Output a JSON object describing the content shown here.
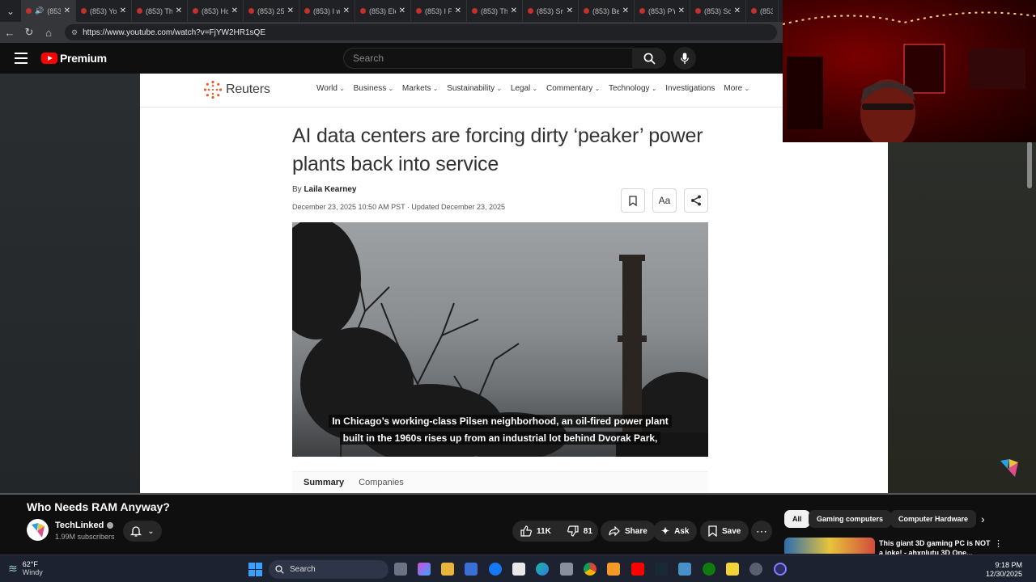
{
  "browser": {
    "tabs": [
      {
        "title": "(853",
        "active": true
      },
      {
        "title": "(853) Yo"
      },
      {
        "title": "(853) Th"
      },
      {
        "title": "(853) Ho"
      },
      {
        "title": "(853) 25"
      },
      {
        "title": "(853) I w"
      },
      {
        "title": "(853) Ele"
      },
      {
        "title": "(853) I F"
      },
      {
        "title": "(853) Th"
      },
      {
        "title": "(853) Sm"
      },
      {
        "title": "(853) Be"
      },
      {
        "title": "(853) PY"
      },
      {
        "title": "(853) So"
      },
      {
        "title": "(853"
      }
    ],
    "url": "https://www.youtube.com/watch?v=FjYW2HR1sQE"
  },
  "youtube": {
    "logo_text": "Premium",
    "search_placeholder": "Search"
  },
  "article": {
    "site": "Reuters",
    "nav": [
      "World",
      "Business",
      "Markets",
      "Sustainability",
      "Legal",
      "Commentary",
      "Technology",
      "Investigations",
      "More"
    ],
    "headline": "AI data centers are forcing dirty ‘peaker’ power plants back into service",
    "by": "By",
    "author": "Laila Kearney",
    "dateline": "December 23, 2025 10:50 AM PST · Updated December 23, 2025",
    "text_size_label": "Aa",
    "caption_line1": "In Chicago’s working-class Pilsen neighborhood, an oil-fired power plant",
    "caption_line2": "built in the 1960s rises up from an industrial lot behind Dvorak Park,",
    "tabs": [
      "Summary",
      "Companies"
    ]
  },
  "video": {
    "title": "Who Needs RAM Anyway?",
    "channel": "TechLinked",
    "subscribers": "1.99M subscribers",
    "likes": "11K",
    "dislikes": "81",
    "share_label": "Share",
    "ask_label": "Ask",
    "save_label": "Save"
  },
  "recommendations": {
    "chips": [
      "All",
      "Gaming computers",
      "Computer Hardware"
    ],
    "first_title": "This giant 3D gaming PC is NOT a joke! - ahxplutu 3D One..."
  },
  "taskbar": {
    "temperature": "62°F",
    "weather": "Windy",
    "search_label": "Search",
    "time": "9:18 PM",
    "date": "12/30/2025"
  },
  "colors": {
    "youtube_red": "#ff0000",
    "reuters_orange": "#e85d2c",
    "taskbar": "#1c2230"
  }
}
